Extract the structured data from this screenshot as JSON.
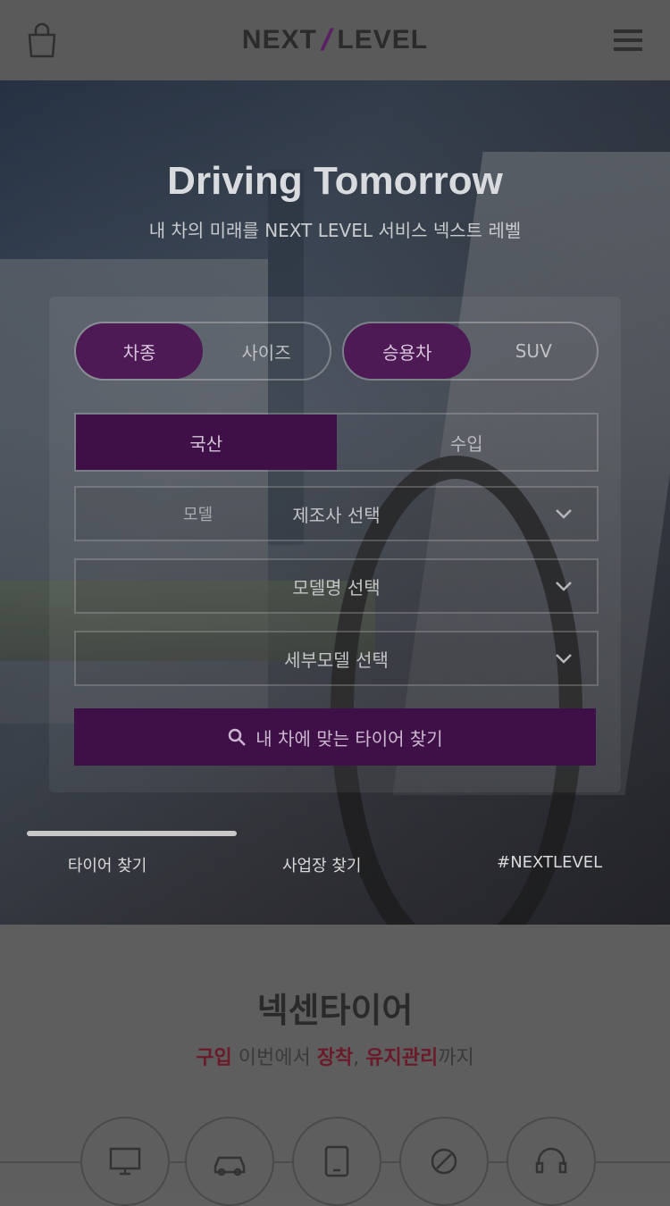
{
  "header": {
    "logo_text_1": "NEXT",
    "logo_text_2": "LEVEL"
  },
  "hero": {
    "title": "Driving Tomorrow",
    "subtitle": "내 차의 미래를 NEXT LEVEL 서비스 넥스트 레벨"
  },
  "toggles": [
    {
      "options": [
        "차종",
        "사이즈"
      ],
      "active": 0
    },
    {
      "options": [
        "승용차",
        "SUV"
      ],
      "active": 0
    }
  ],
  "segments": {
    "options": [
      "국산",
      "수입"
    ],
    "active": 0
  },
  "selects": [
    {
      "label_left": "모델",
      "value": "제조사 선택"
    },
    {
      "label_left": "",
      "value": "모델명 선택"
    },
    {
      "label_left": "",
      "value": "세부모델 선택"
    }
  ],
  "cta": {
    "label": "내 차에 맞는 타이어 찾기"
  },
  "bottom_tabs": [
    "타이어 찾기",
    "사업장 찾기",
    "#NEXTLEVEL"
  ],
  "section": {
    "title": "넥센타이어",
    "subtitle_parts": [
      "구입",
      " 이번에서 ",
      "장착",
      ", ",
      "유지관리",
      "까지"
    ]
  },
  "service_icons": [
    "monitor-icon",
    "car-icon",
    "tablet-icon",
    "tire-wrench-icon",
    "headset-icon"
  ],
  "colors": {
    "accent": "#4d1a56",
    "highlight": "#6b1a2a"
  }
}
